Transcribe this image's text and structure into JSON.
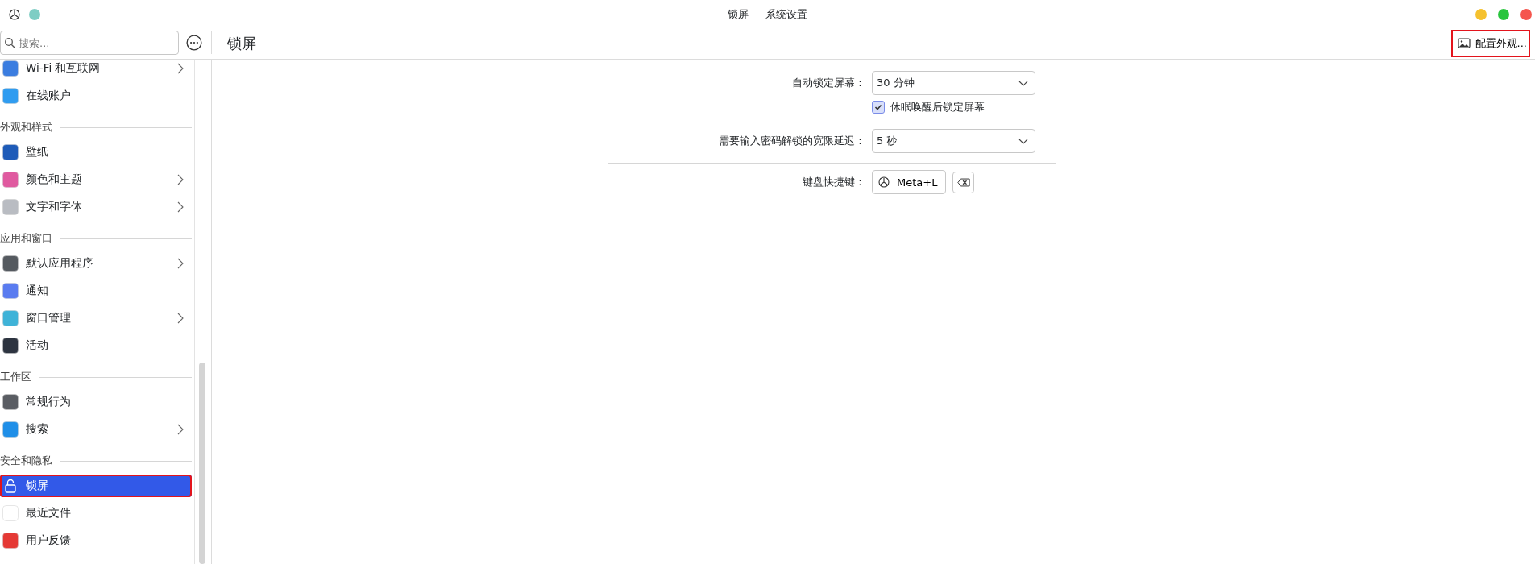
{
  "window": {
    "title": "锁屏 — 系统设置"
  },
  "search": {
    "placeholder": "搜索..."
  },
  "sidebar": {
    "items": [
      {
        "kind": "item",
        "label": "Wi-Fi 和互联网",
        "has_submenu": true,
        "selected": false,
        "highlighted": false
      },
      {
        "kind": "item",
        "label": "在线账户",
        "has_submenu": false,
        "selected": false,
        "highlighted": false
      },
      {
        "kind": "header",
        "label": "外观和样式"
      },
      {
        "kind": "item",
        "label": "壁纸",
        "has_submenu": false,
        "selected": false,
        "highlighted": false
      },
      {
        "kind": "item",
        "label": "颜色和主题",
        "has_submenu": true,
        "selected": false,
        "highlighted": false
      },
      {
        "kind": "item",
        "label": "文字和字体",
        "has_submenu": true,
        "selected": false,
        "highlighted": false
      },
      {
        "kind": "header",
        "label": "应用和窗口"
      },
      {
        "kind": "item",
        "label": "默认应用程序",
        "has_submenu": true,
        "selected": false,
        "highlighted": false
      },
      {
        "kind": "item",
        "label": "通知",
        "has_submenu": false,
        "selected": false,
        "highlighted": false
      },
      {
        "kind": "item",
        "label": "窗口管理",
        "has_submenu": true,
        "selected": false,
        "highlighted": false
      },
      {
        "kind": "item",
        "label": "活动",
        "has_submenu": false,
        "selected": false,
        "highlighted": false
      },
      {
        "kind": "header",
        "label": "工作区"
      },
      {
        "kind": "item",
        "label": "常规行为",
        "has_submenu": false,
        "selected": false,
        "highlighted": false
      },
      {
        "kind": "item",
        "label": "搜索",
        "has_submenu": true,
        "selected": false,
        "highlighted": false
      },
      {
        "kind": "header",
        "label": "安全和隐私"
      },
      {
        "kind": "item",
        "label": "锁屏",
        "has_submenu": false,
        "selected": true,
        "highlighted": true
      },
      {
        "kind": "item",
        "label": "最近文件",
        "has_submenu": false,
        "selected": false,
        "highlighted": false
      },
      {
        "kind": "item",
        "label": "用户反馈",
        "has_submenu": false,
        "selected": false,
        "highlighted": false
      }
    ]
  },
  "page": {
    "title": "锁屏",
    "configure_button": {
      "label": "配置外观...",
      "highlighted": true
    }
  },
  "form": {
    "auto_lock": {
      "label": "自动锁定屏幕：",
      "value": "30 分钟"
    },
    "lock_after_wake": {
      "label": "休眠唤醒后锁定屏幕",
      "checked": true
    },
    "grace_delay": {
      "label": "需要输入密码解锁的宽限延迟：",
      "value": "5 秒"
    },
    "shortcut": {
      "label": "键盘快捷键：",
      "value": "Meta+L"
    }
  }
}
